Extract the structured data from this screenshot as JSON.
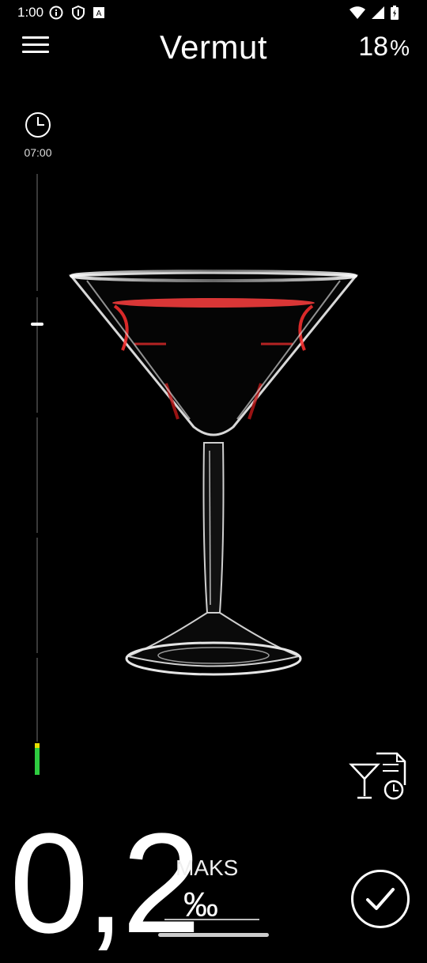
{
  "status": {
    "time": "1:00"
  },
  "header": {
    "title": "Vermut",
    "abv_value": "18",
    "abv_unit": "%"
  },
  "timer": {
    "label": "07:00"
  },
  "reading": {
    "value": "0,2",
    "max_label": "MAKS",
    "unit": "‰"
  },
  "level_indicator": {
    "fill_fraction": 0.04,
    "colors": [
      "#e8e000",
      "#2ecc40"
    ]
  },
  "icons": {
    "menu": "hamburger-menu-icon",
    "clock": "clock-icon",
    "history": "drink-history-icon",
    "confirm": "checkmark-icon"
  }
}
